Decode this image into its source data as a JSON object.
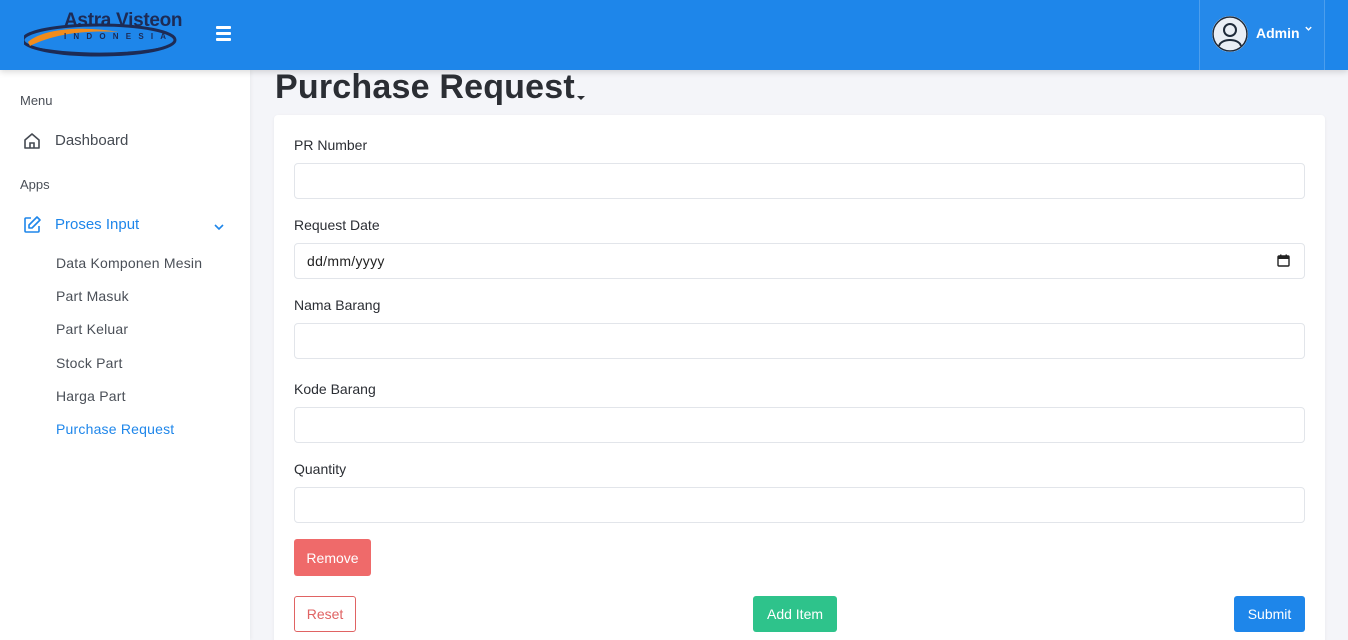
{
  "colors": {
    "primary": "#1e86ea",
    "danger": "#ef6a6a",
    "success": "#2ec38b",
    "background": "#f4f5f9"
  },
  "header": {
    "logo_title": "Astra Visteon",
    "logo_subtitle": "INDONESIA",
    "menu_icon": "hamburger-icon",
    "user": {
      "name": "Admin",
      "avatar_icon": "user-avatar-icon",
      "caret_icon": "chevron-down-icon"
    }
  },
  "sidebar": {
    "menu_label": "Menu",
    "dashboard": {
      "label": "Dashboard",
      "icon": "home-icon"
    },
    "apps_label": "Apps",
    "proses_input": {
      "label": "Proses Input",
      "icon": "edit-icon",
      "expanded": true,
      "items": [
        {
          "label": "Data Komponen Mesin",
          "active": false
        },
        {
          "label": "Part Masuk",
          "active": false
        },
        {
          "label": "Part Keluar",
          "active": false
        },
        {
          "label": "Stock Part",
          "active": false
        },
        {
          "label": "Harga Part",
          "active": false
        },
        {
          "label": "Purchase Request",
          "active": true
        }
      ]
    }
  },
  "main": {
    "title": "Purchase Request",
    "form": {
      "pr_number": {
        "label": "PR Number",
        "value": "",
        "placeholder": ""
      },
      "request_date": {
        "label": "Request Date",
        "value": "dd/mm/yyyy",
        "icon": "calendar-icon"
      },
      "nama_barang": {
        "label": "Nama Barang",
        "value": "",
        "placeholder": ""
      },
      "kode_barang": {
        "label": "Kode Barang",
        "value": "",
        "placeholder": ""
      },
      "quantity": {
        "label": "Quantity",
        "value": "",
        "placeholder": ""
      }
    },
    "buttons": {
      "remove": "Remove",
      "reset": "Reset",
      "add_item": "Add Item",
      "submit": "Submit"
    }
  }
}
